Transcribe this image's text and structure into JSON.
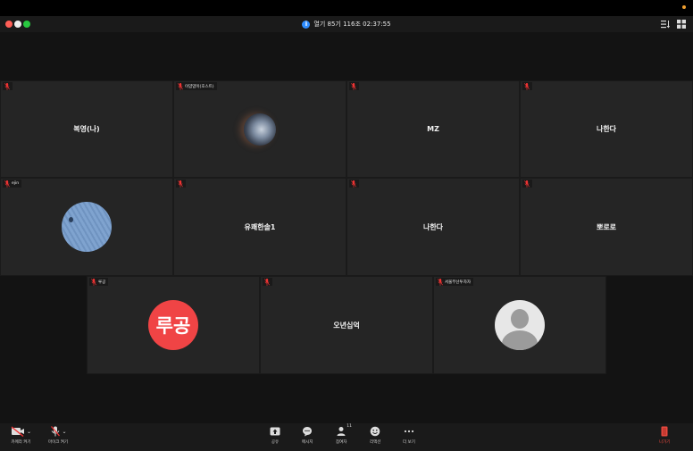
{
  "window": {
    "title": "열기 85기 116조 02:37:55"
  },
  "tiles": [
    {
      "id": "t1",
      "label": "복영(나)",
      "name_tag": ""
    },
    {
      "id": "t2",
      "label": "",
      "name_tag": "이얌얌이(호스트)"
    },
    {
      "id": "t3",
      "label": "MZ",
      "name_tag": ""
    },
    {
      "id": "t4",
      "label": "나한다",
      "name_tag": ""
    },
    {
      "id": "t5",
      "label": "",
      "name_tag": "ejin"
    },
    {
      "id": "t6",
      "label": "유쾌한솔1",
      "name_tag": ""
    },
    {
      "id": "t7",
      "label": "나한다",
      "name_tag": ""
    },
    {
      "id": "t8",
      "label": "뽀로로",
      "name_tag": ""
    },
    {
      "id": "t9",
      "label": "",
      "name_tag": "루공",
      "avatar_text": "루공"
    },
    {
      "id": "t10",
      "label": "오년십억",
      "name_tag": ""
    },
    {
      "id": "t11",
      "label": "",
      "name_tag": "서울부산투자자"
    }
  ],
  "toolbar": {
    "camera": "카메라 켜기",
    "mic": "마이크 켜기",
    "share": "공유",
    "message": "메시지",
    "participants": "참여자",
    "participants_count": "11",
    "reaction": "리액션",
    "more": "더 보기",
    "leave": "나가기"
  },
  "colors": {
    "accent": "#2d8cff",
    "leave": "#e8483e",
    "avatar_red": "#f04445"
  }
}
